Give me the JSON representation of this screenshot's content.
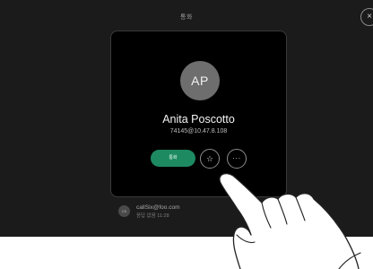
{
  "screen": {
    "title": "통화"
  },
  "close": {
    "glyph": "×"
  },
  "contact": {
    "initials": "AP",
    "name": "Anita Poscotto",
    "address": "74145@10.47.8.108"
  },
  "actions": {
    "call_label": "통화",
    "favorite_icon": "☆",
    "more_icon": "···"
  },
  "recent": {
    "initials": "CK",
    "name": "callSix@foo.com",
    "detail": "응답 없음 11:28"
  },
  "colors": {
    "screen_bg": "#1b1b1b",
    "card_bg": "#000000",
    "call_button": "#1e8a62",
    "avatar": "#6e6e6e"
  }
}
